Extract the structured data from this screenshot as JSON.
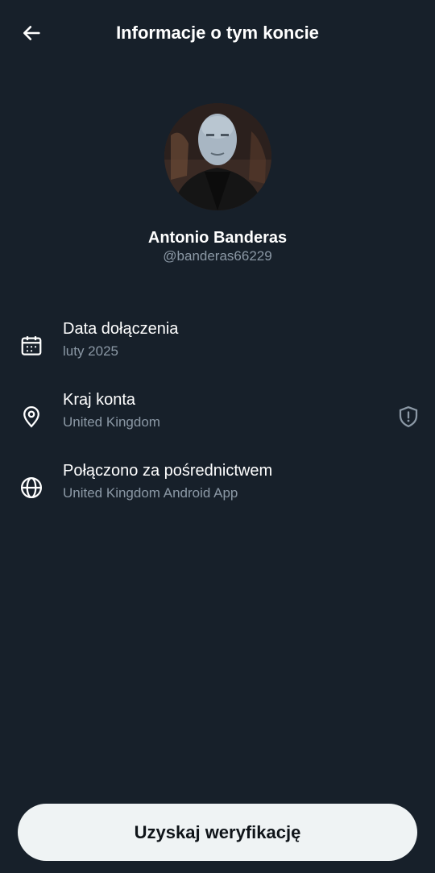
{
  "header": {
    "title": "Informacje o tym koncie",
    "back_icon": "arrow-left-icon"
  },
  "profile": {
    "name": "Antonio Banderas",
    "handle": "@banderas66229"
  },
  "details": [
    {
      "icon": "calendar-icon",
      "label": "Data dołączenia",
      "value": "luty 2025"
    },
    {
      "icon": "location-pin-icon",
      "label": "Kraj konta",
      "value": "United Kingdom",
      "extra_icon": "shield-alert-icon"
    },
    {
      "icon": "globe-icon",
      "label": "Połączono za pośrednictwem",
      "value": "United Kingdom Android App"
    }
  ],
  "cta": {
    "label": "Uzyskaj weryfikację"
  },
  "colors": {
    "background": "#17202a",
    "primary_text": "#ffffff",
    "secondary_text": "#8b98a5",
    "button_bg": "#eff3f4",
    "button_text": "#0f1419"
  }
}
